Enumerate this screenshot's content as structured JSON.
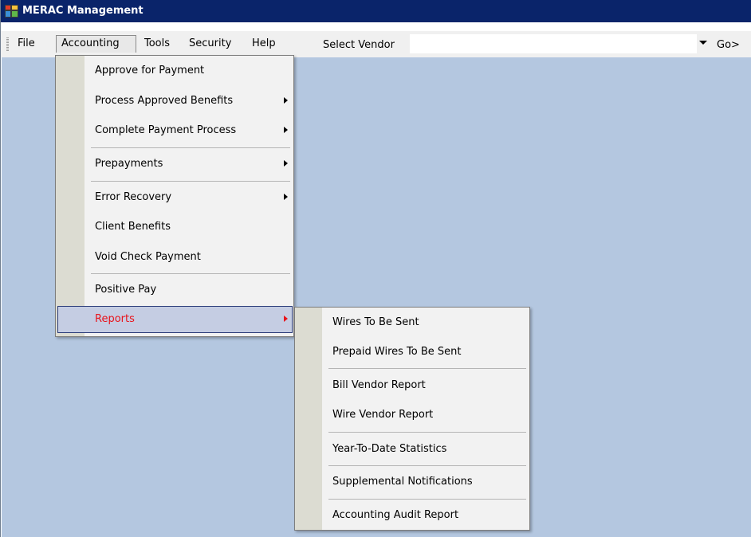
{
  "window": {
    "title": "MERAC Management"
  },
  "menubar": {
    "items": [
      {
        "label": "File"
      },
      {
        "label": "Accounting"
      },
      {
        "label": "Tools"
      },
      {
        "label": "Security"
      },
      {
        "label": "Help"
      }
    ],
    "vendor_label": "Select Vendor",
    "vendor_value": "",
    "go_label": "Go>"
  },
  "accounting_menu": {
    "items": [
      {
        "label": "Approve for Payment",
        "submenu": false
      },
      {
        "label": "Process Approved Benefits",
        "submenu": true
      },
      {
        "label": "Complete Payment Process",
        "submenu": true
      },
      {
        "label": "Prepayments",
        "submenu": true
      },
      {
        "label": "Error Recovery",
        "submenu": true
      },
      {
        "label": "Client Benefits",
        "submenu": false
      },
      {
        "label": "Void Check Payment",
        "submenu": false
      },
      {
        "label": "Positive Pay",
        "submenu": false
      },
      {
        "label": "Reports",
        "submenu": true,
        "highlighted": true
      }
    ]
  },
  "reports_menu": {
    "items": [
      {
        "label": "Wires To Be Sent"
      },
      {
        "label": "Prepaid Wires To Be Sent"
      },
      {
        "label": "Bill Vendor Report"
      },
      {
        "label": "Wire Vendor Report"
      },
      {
        "label": "Year-To-Date Statistics"
      },
      {
        "label": "Supplemental Notifications"
      },
      {
        "label": "Accounting Audit Report"
      }
    ]
  },
  "colors": {
    "titlebar": "#0a246a",
    "workspace": "#b4c7e0",
    "menubar": "#f0f0f0",
    "highlight_text": "#e8141c"
  },
  "icons": [
    "app-icon",
    "submenu-arrow-icon",
    "dropdown-arrow-icon",
    "toolbar-grip-icon"
  ]
}
